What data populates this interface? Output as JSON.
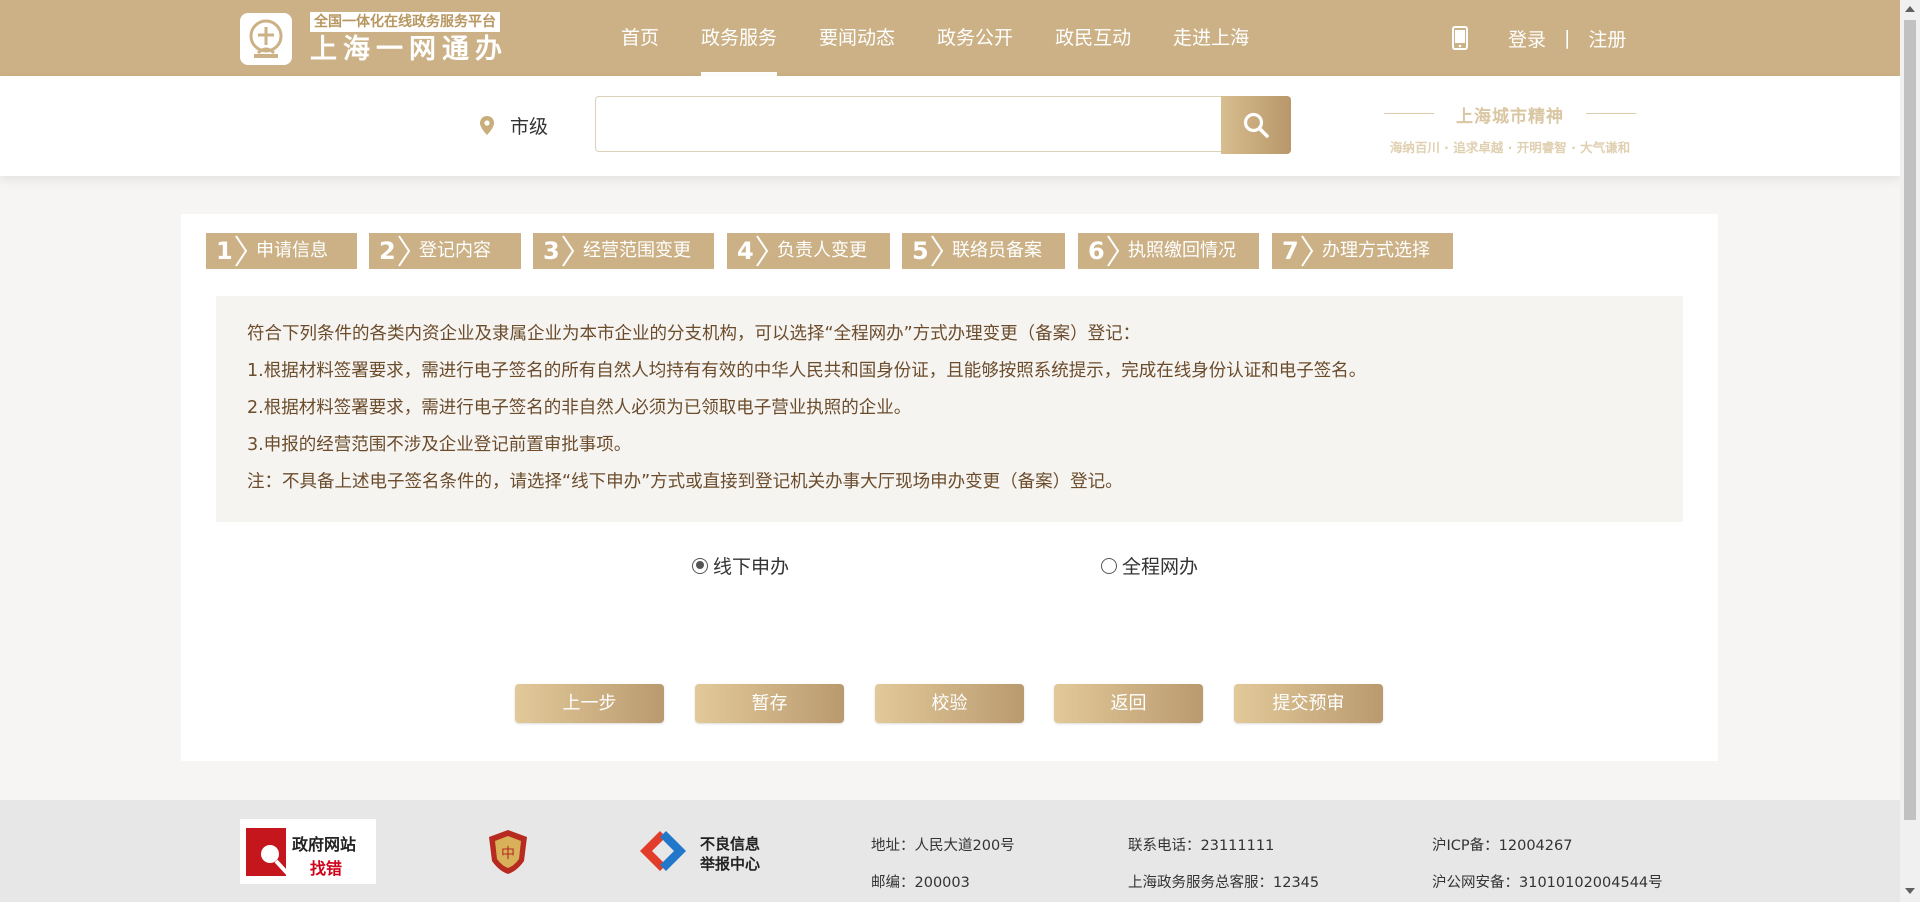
{
  "header": {
    "logo_tag": "全国一体化在线政务服务平台",
    "logo_title": "上海一网通办",
    "nav": [
      {
        "label": "首页"
      },
      {
        "label": "政务服务",
        "active": true
      },
      {
        "label": "要闻动态"
      },
      {
        "label": "政务公开"
      },
      {
        "label": "政民互动"
      },
      {
        "label": "走进上海"
      }
    ],
    "login": "登录",
    "separator": "|",
    "register": "注册"
  },
  "search": {
    "location": "市级",
    "placeholder": "",
    "value": ""
  },
  "spirit": {
    "title": "上海城市精神",
    "subtitle": "海纳百川 · 追求卓越 · 开明睿智 · 大气谦和"
  },
  "steps": [
    {
      "num": "1",
      "label": "申请信息"
    },
    {
      "num": "2",
      "label": "登记内容"
    },
    {
      "num": "3",
      "label": "经营范围变更"
    },
    {
      "num": "4",
      "label": "负责人变更"
    },
    {
      "num": "5",
      "label": "联络员备案"
    },
    {
      "num": "6",
      "label": "执照缴回情况"
    },
    {
      "num": "7",
      "label": "办理方式选择"
    }
  ],
  "notice": {
    "lines": [
      "符合下列条件的各类内资企业及隶属企业为本市企业的分支机构，可以选择“全程网办”方式办理变更（备案）登记：",
      "1.根据材料签署要求，需进行电子签名的所有自然人均持有有效的中华人民共和国身份证，且能够按照系统提示，完成在线身份认证和电子签名。",
      "2.根据材料签署要求，需进行电子签名的非自然人必须为已领取电子营业执照的企业。",
      "3.申报的经营范围不涉及企业登记前置审批事项。",
      "注：不具备上述电子签名条件的，请选择“线下申办”方式或直接到登记机关办事大厅现场申办变更（备案）登记。"
    ]
  },
  "options": [
    {
      "label": "线下申办",
      "checked": true
    },
    {
      "label": "全程网办",
      "checked": false
    }
  ],
  "buttons": {
    "prev": "上一步",
    "save": "暂存",
    "validate": "校验",
    "back": "返回",
    "submit": "提交预审"
  },
  "footer": {
    "logo1_line1": "政府网站",
    "logo1_line2": "找错",
    "logo3_line1": "不良信息",
    "logo3_line2": "举报中心",
    "address": "地址：人民大道200号",
    "postcode": "邮编：200003",
    "phone": "联系电话：23111111",
    "hotline": "上海政务服务总客服：12345",
    "icp": "沪ICP备：12004267",
    "police": "沪公网安备：31010102004544号"
  },
  "colors": {
    "brand": "#cbb185",
    "button_gradient_start": "#e2c99a",
    "button_gradient_end": "#b99a6e",
    "notice_text": "#6b4c2d"
  },
  "icons": [
    "phone-icon",
    "location-pin-icon",
    "search-icon",
    "chevron-right-icon",
    "shield-emblem-icon",
    "report-icon",
    "magnifier-logo-icon"
  ]
}
